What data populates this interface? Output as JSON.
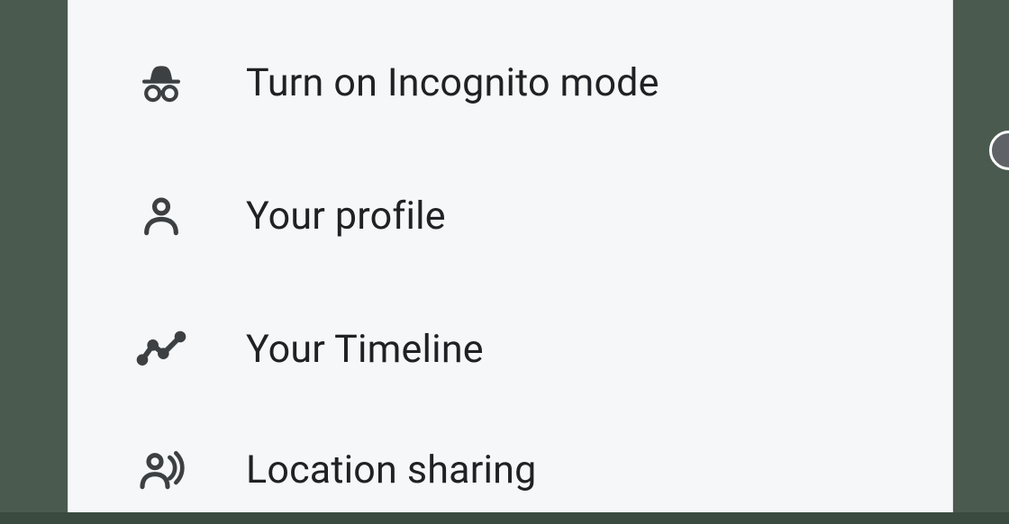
{
  "menu": {
    "items": [
      {
        "id": "incognito",
        "label": "Turn on Incognito mode"
      },
      {
        "id": "profile",
        "label": "Your profile"
      },
      {
        "id": "timeline",
        "label": "Your Timeline"
      },
      {
        "id": "location-sharing",
        "label": "Location sharing"
      }
    ]
  }
}
